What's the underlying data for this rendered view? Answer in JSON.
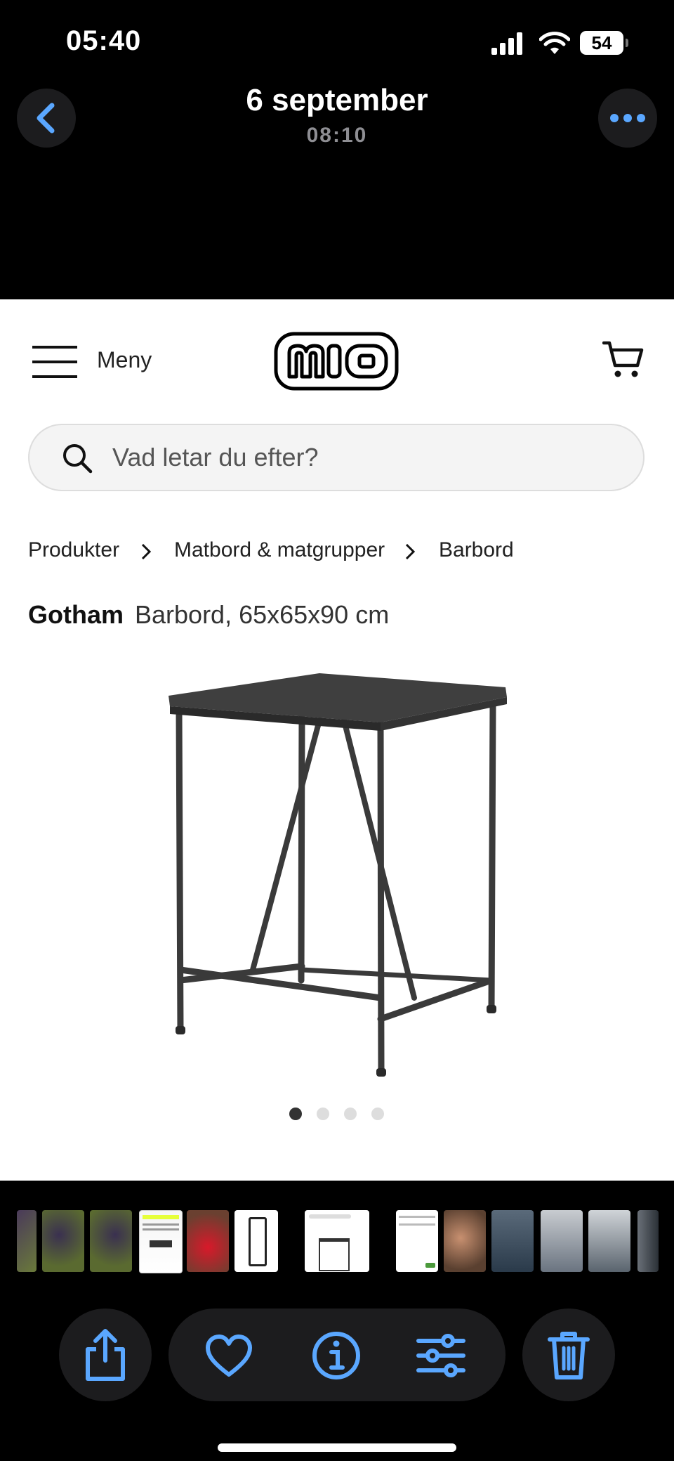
{
  "status": {
    "time": "05:40",
    "battery": "54"
  },
  "header": {
    "date": "6 september",
    "time": "08:10"
  },
  "site": {
    "menu_label": "Meny",
    "logo_text": "mio",
    "search_placeholder": "Vad letar du efter?",
    "breadcrumb": [
      "Produkter",
      "Matbord & matgrupper",
      "Barbord"
    ],
    "product": {
      "brand": "Gotham",
      "description": "Barbord, 65x65x90 cm"
    },
    "carousel": {
      "count": 4,
      "active": 1
    }
  },
  "thumbnails": [
    "grapes",
    "grapes",
    "grapes",
    "webpage",
    "red chair",
    "bar chair",
    "bar table",
    "webpage",
    "selfie",
    "construction",
    "fog",
    "fog",
    "fog"
  ],
  "toolbar": [
    "share-icon",
    "heart-icon",
    "info-icon",
    "sliders-icon",
    "trash-icon"
  ],
  "colors": {
    "accent": "#5aa7ff",
    "button_bg": "#1c1c1e",
    "background": "#000000"
  }
}
